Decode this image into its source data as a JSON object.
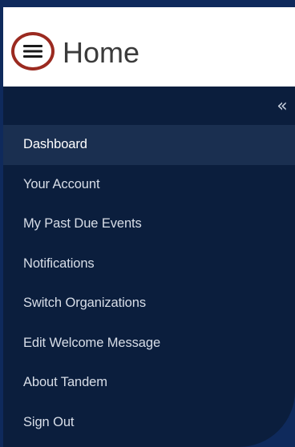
{
  "header": {
    "menu_icon": "hamburger-icon",
    "title": "Home"
  },
  "sidebar": {
    "collapse_icon": "double-chevron-left-icon",
    "collapse_glyph": "«",
    "items": [
      {
        "label": "Dashboard",
        "active": true
      },
      {
        "label": "Your Account",
        "active": false
      },
      {
        "label": "My Past Due Events",
        "active": false
      },
      {
        "label": "Notifications",
        "active": false
      },
      {
        "label": "Switch Organizations",
        "active": false
      },
      {
        "label": "Edit Welcome Message",
        "active": false
      },
      {
        "label": "About Tandem",
        "active": false
      },
      {
        "label": "Sign Out",
        "active": false
      }
    ]
  },
  "colors": {
    "background": "#0f2a5c",
    "sidebar": "#0b1e3d",
    "active_row": "#1a2f50",
    "highlight_ring": "#9b2a20"
  }
}
